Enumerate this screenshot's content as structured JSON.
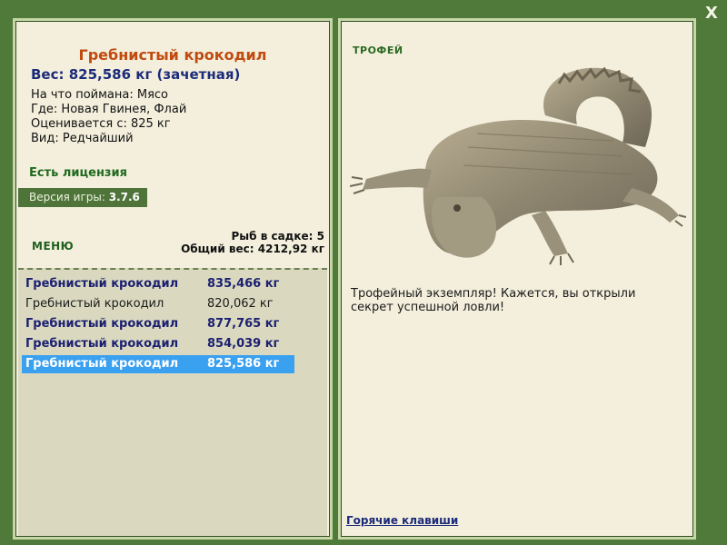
{
  "close_label": "X",
  "fish": {
    "title": "Гребнистый крокодил",
    "weight": "Вес: 825,586 кг (зачетная)",
    "bait": "На что поймана: Мясо",
    "location": "Где: Новая Гвинея, Флай",
    "value": "Оценивается с: 825 кг",
    "rarity": "Вид: Редчайший"
  },
  "license": "Есть лицензия",
  "version": {
    "label": "Версия игры:",
    "value": "3.7.6"
  },
  "menu_label": "МЕНЮ",
  "stats": {
    "count": "Рыб в садке: 5",
    "total": "Общий вес: 4212,92 кг"
  },
  "catch_list": [
    {
      "name": "Гребнистый крокодил",
      "weight": "835,466 кг"
    },
    {
      "name": "Гребнистый крокодил",
      "weight": "820,062 кг"
    },
    {
      "name": "Гребнистый крокодил",
      "weight": "877,765 кг"
    },
    {
      "name": "Гребнистый крокодил",
      "weight": "854,039 кг"
    },
    {
      "name": "Гребнистый крокодил",
      "weight": "825,586 кг"
    }
  ],
  "trophy_label": "ТРОФЕЙ",
  "trophy_text": "Трофейный экземпляр! Кажется, вы открыли секрет успешной ловли!",
  "hotkeys_label": "Горячие клавиши",
  "colors": {
    "background": "#4f7a3a",
    "panel": "#f3efdc",
    "accent_title": "#c04a10",
    "selected_row": "#3aa0f0"
  }
}
